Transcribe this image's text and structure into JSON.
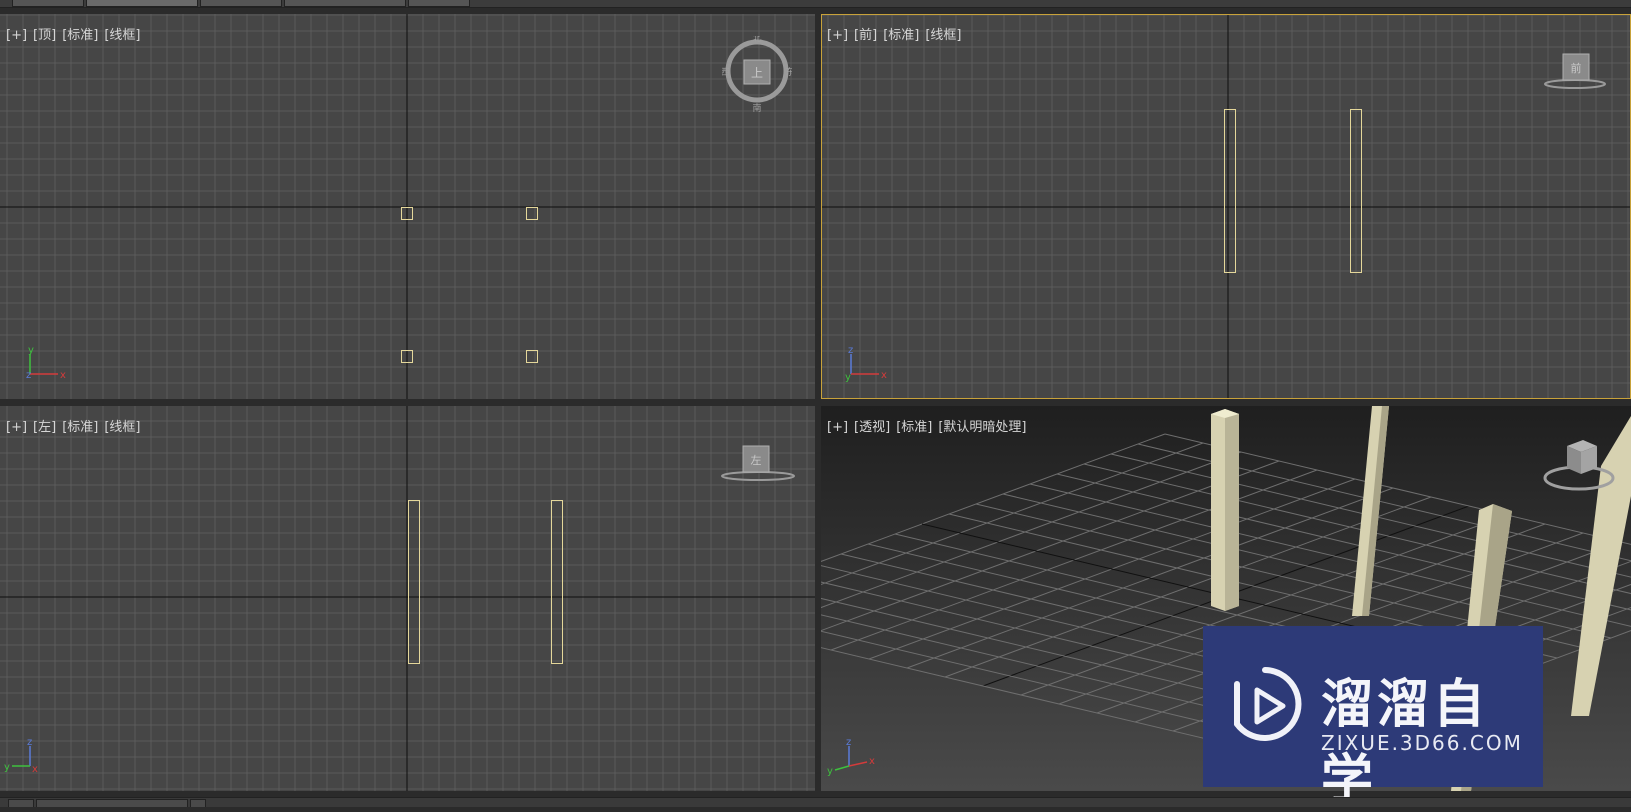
{
  "viewports": {
    "top": {
      "plus": "[+]",
      "view": "[顶]",
      "shading": "[标准]",
      "mode": "[线框]",
      "cube_face": "上",
      "compass": {
        "n": "北",
        "s": "南",
        "e": "东",
        "w": "西"
      }
    },
    "front": {
      "plus": "[+]",
      "view": "[前]",
      "shading": "[标准]",
      "mode": "[线框]",
      "cube_face": "前"
    },
    "left": {
      "plus": "[+]",
      "view": "[左]",
      "shading": "[标准]",
      "mode": "[线框]",
      "cube_face": "左"
    },
    "perspective": {
      "plus": "[+]",
      "view": "[透视]",
      "shading": "[标准]",
      "mode": "[默认明暗处理]"
    }
  },
  "axes": {
    "x": "x",
    "y": "y",
    "z": "z"
  },
  "watermark": {
    "title": "溜溜自学",
    "url": "ZIXUE.3D66.COM"
  },
  "colors": {
    "grid_bg": "#464646",
    "grid_line": "#5b5b5b",
    "selection": "#e4d79a",
    "active_border": "#c8a23a",
    "column": "#d7d2b1",
    "watermark_bg": "#2d3a78"
  }
}
